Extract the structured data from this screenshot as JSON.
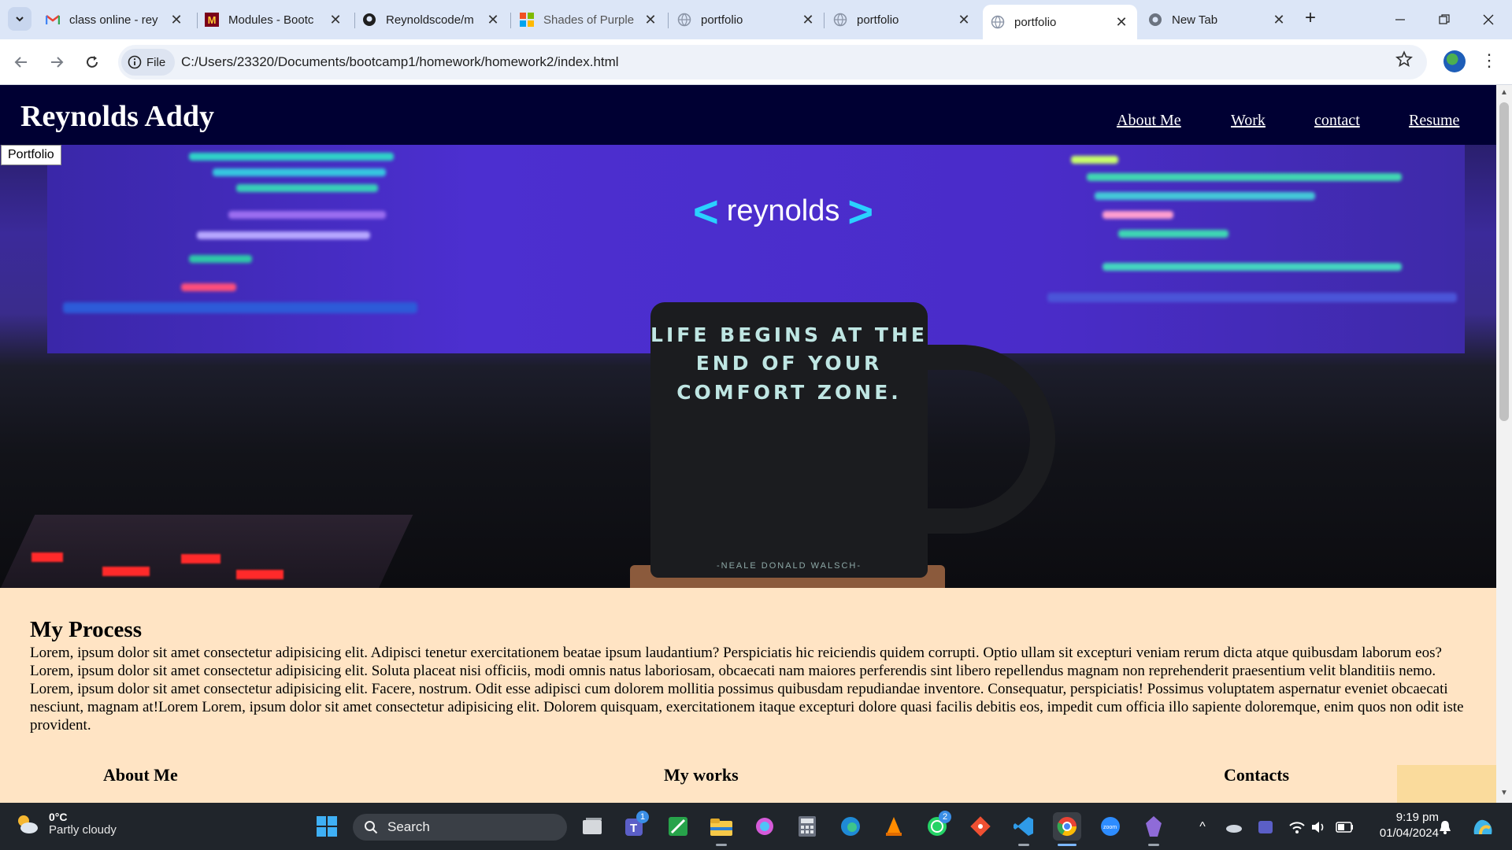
{
  "browser": {
    "tabs": [
      {
        "title": "class online - rey",
        "icon": "gmail-icon",
        "active": false
      },
      {
        "title": "Modules - Bootc",
        "icon": "university-icon",
        "active": false
      },
      {
        "title": "Reynoldscode/m",
        "icon": "github-icon",
        "active": false
      },
      {
        "title": "Shades of Purple",
        "icon": "microsoft-icon",
        "active": false
      },
      {
        "title": "portfolio",
        "icon": "globe-icon",
        "active": false
      },
      {
        "title": "portfolio",
        "icon": "globe-icon",
        "active": false
      },
      {
        "title": "portfolio",
        "icon": "globe-icon",
        "active": true
      },
      {
        "title": "New Tab",
        "icon": "chrome-icon",
        "active": false
      }
    ],
    "chip_label": "File",
    "url": "C:/Users/23320/Documents/bootcamp1/homework/homework2/index.html",
    "accent_color": "#dce6f7"
  },
  "page": {
    "site_title": "Reynolds Addy",
    "nav": [
      "About Me",
      "Work",
      "contact",
      "Resume"
    ],
    "portfolio_tag": "Portfolio",
    "hero": {
      "brand_left": "<",
      "brand_text": "reynolds",
      "brand_right": ">",
      "mug_text": "LIFE BEGINS AT THE END OF YOUR COMFORT ZONE.",
      "mug_author": "-NEALE DONALD WALSCH-"
    },
    "process": {
      "heading": "My Process",
      "body": "Lorem, ipsum dolor sit amet consectetur adipisicing elit. Adipisci tenetur exercitationem beatae ipsum laudantium? Perspiciatis hic reiciendis quidem corrupti. Optio ullam sit excepturi veniam rerum dicta atque quibusdam laborum eos?Lorem, ipsum dolor sit amet consectetur adipisicing elit. Soluta placeat nisi officiis, modi omnis natus laboriosam, obcaecati nam maiores perferendis sint libero repellendus magnam non reprehenderit praesentium velit blanditiis nemo. Lorem, ipsum dolor sit amet consectetur adipisicing elit. Facere, nostrum. Odit esse adipisci cum dolorem mollitia possimus quibusdam repudiandae inventore. Consequatur, perspiciatis! Possimus voluptatem aspernatur eveniet obcaecati nesciunt, magnam at!Lorem Lorem, ipsum dolor sit amet consectetur adipisicing elit. Dolorem quisquam, exercitationem itaque excepturi dolore quasi facilis debitis eos, impedit cum officia illo sapiente doloremque, enim quos non odit iste provident."
    },
    "columns": [
      "About Me",
      "My works",
      "Contacts"
    ],
    "colors": {
      "header_bg": "#000033",
      "page_bg": "#ffe4c4",
      "brand_bracket": "#2ad1ff",
      "accent_box": "#fadb9c"
    }
  },
  "taskbar": {
    "weather_temp": "0°C",
    "weather_cond": "Partly cloudy",
    "search_label": "Search",
    "time": "9:19 pm",
    "date": "01/04/2024",
    "badges": {
      "teams": "1",
      "whatsapp": "2"
    }
  }
}
